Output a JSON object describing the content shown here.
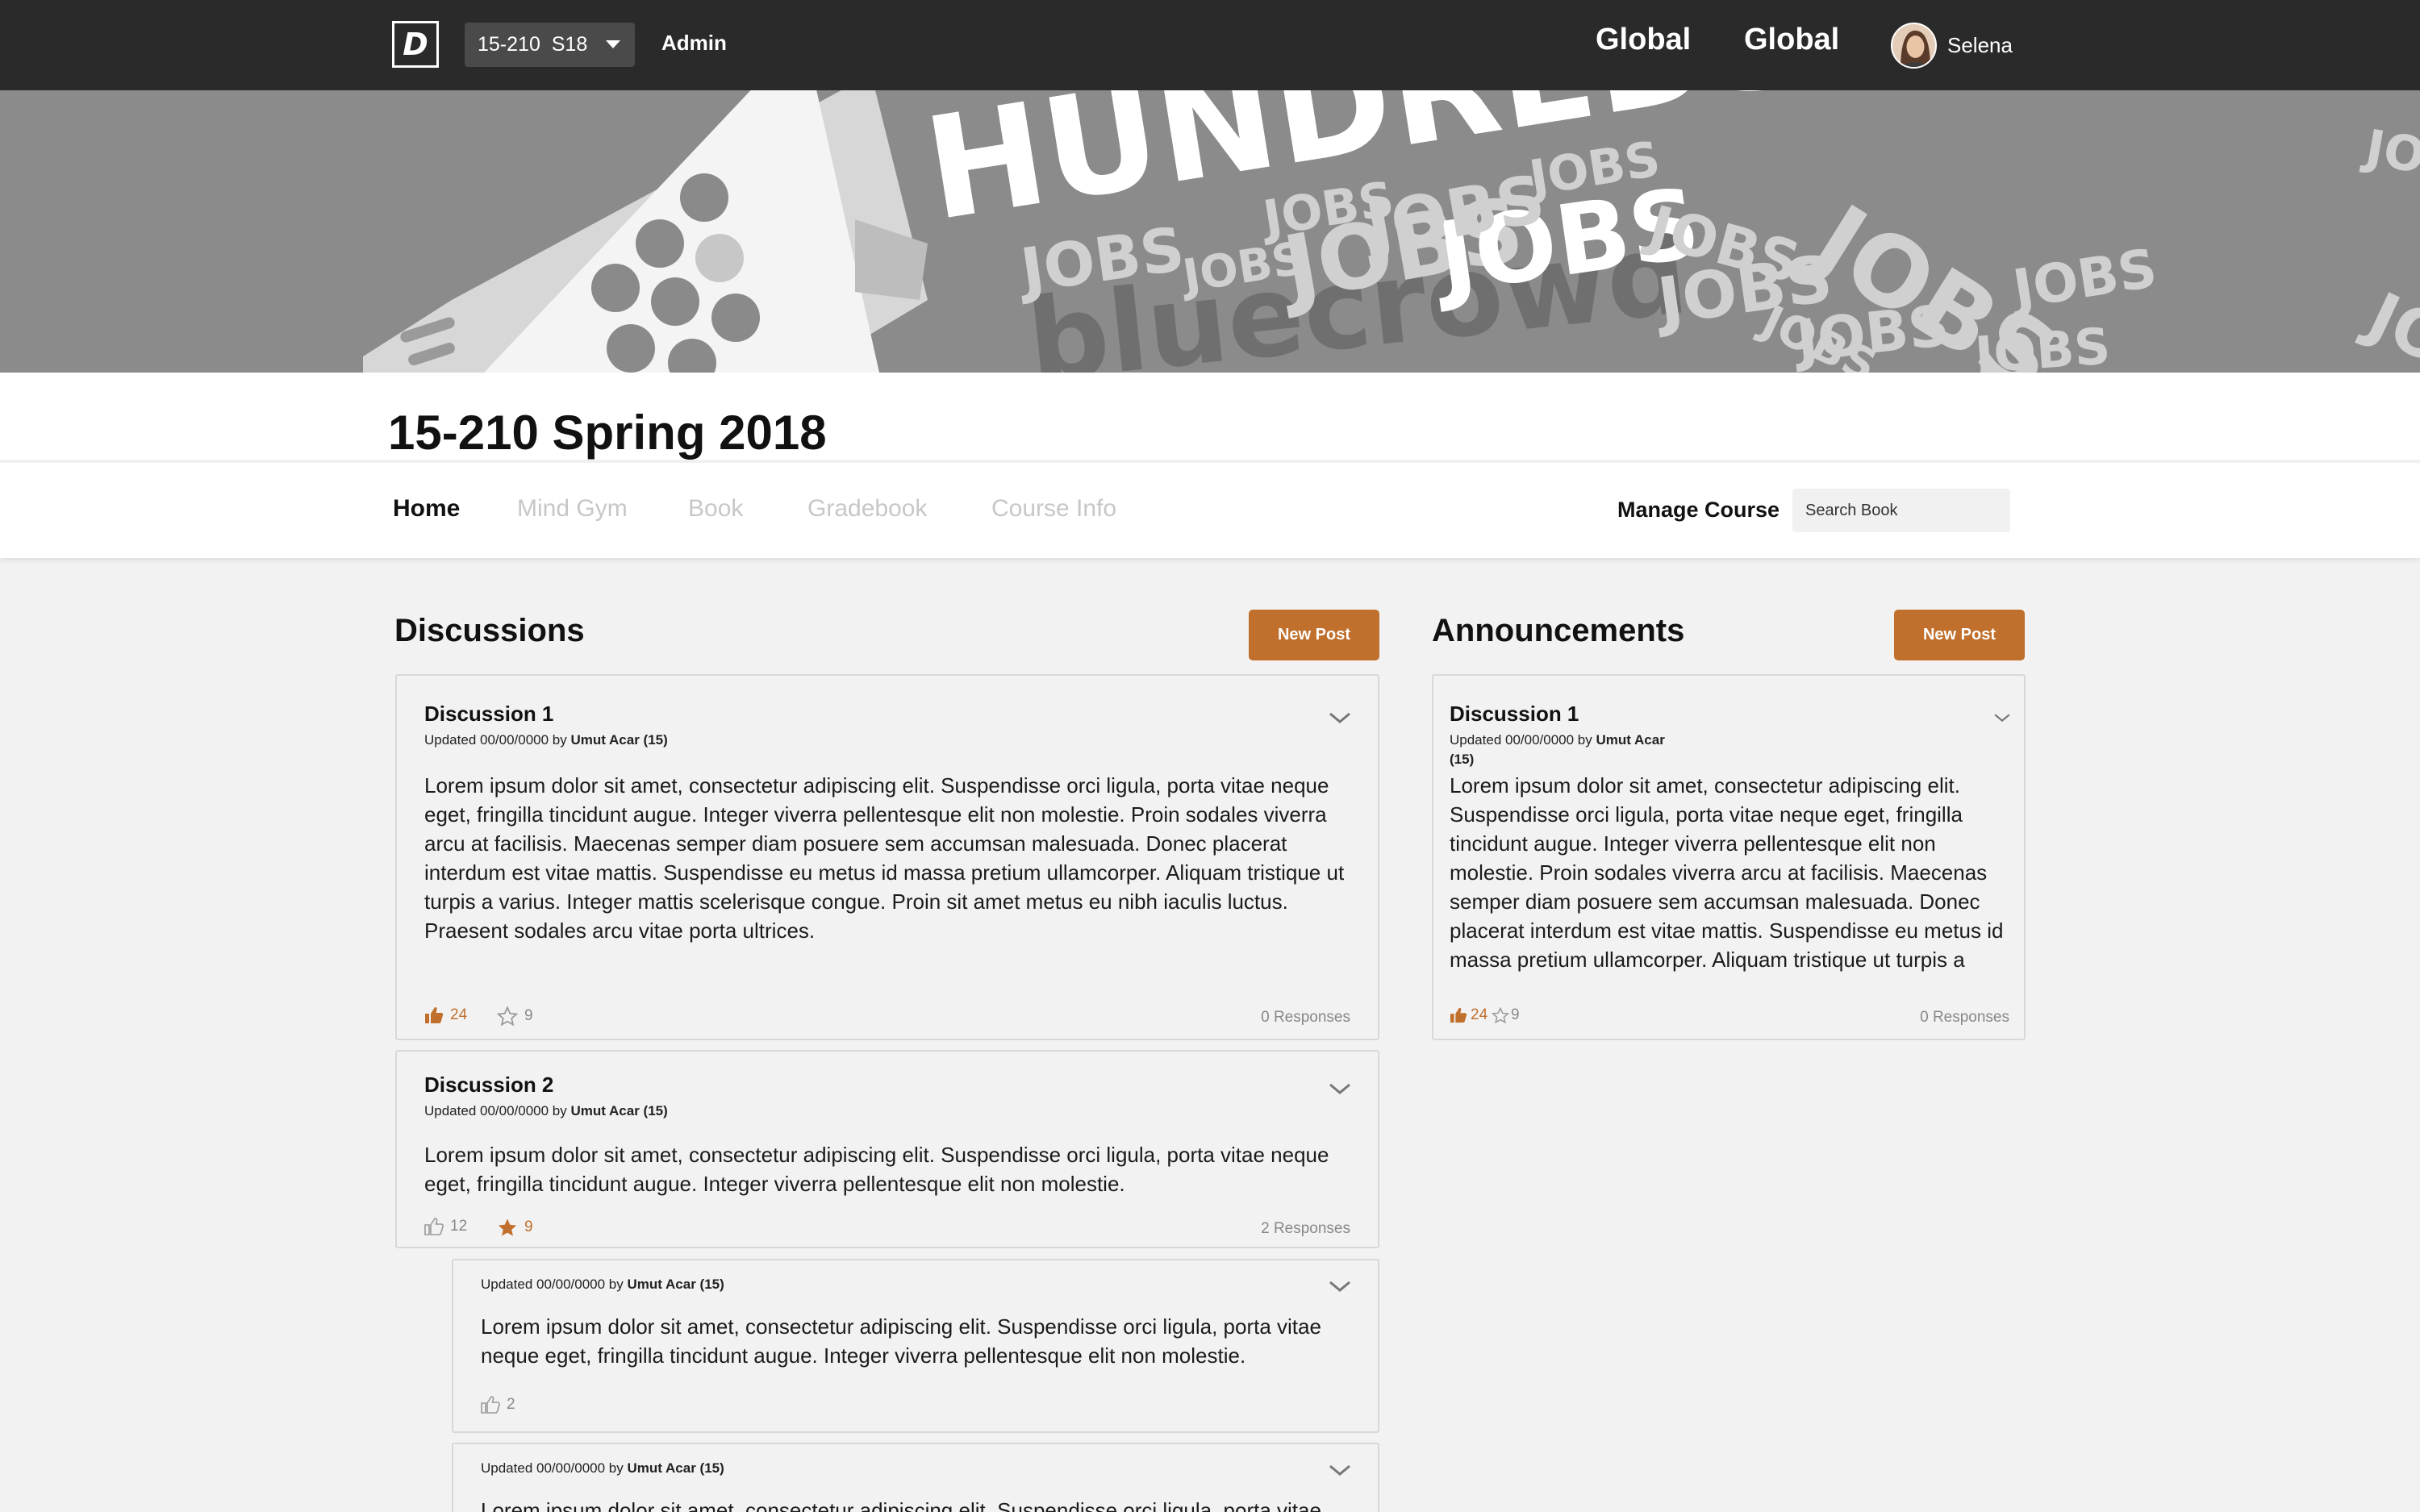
{
  "topbar": {
    "logo_letter": "D",
    "course_selector": "15-210  S18",
    "admin_label": "Admin",
    "global_links": [
      "Global",
      "Global"
    ],
    "user_name": "Selena"
  },
  "banner": {
    "big_text": "HUNDREDS OF JOBS",
    "repeat_word": "JOBS",
    "bottom_text": "bluecrowd"
  },
  "course": {
    "title": "15-210 Spring 2018"
  },
  "nav": {
    "tabs": [
      "Home",
      "Mind Gym",
      "Book",
      "Gradebook",
      "Course Info"
    ],
    "active_tab": "Home",
    "manage_course": "Manage Course",
    "search_placeholder": "Search Book"
  },
  "discussions": {
    "heading": "Discussions",
    "new_post_label": "New Post",
    "posts": [
      {
        "title": "Discussion 1",
        "meta_prefix": "Updated 00/00/0000 by",
        "author": "Umut Acar (15)",
        "body": "Lorem ipsum dolor sit amet, consectetur adipiscing elit. Suspendisse orci ligula, porta vitae neque eget, fringilla tincidunt augue. Integer viverra pellentesque elit non molestie. Proin sodales viverra arcu at facilisis. Maecenas semper diam posuere sem accumsan malesuada. Donec placerat interdum est vitae mattis. Suspendisse eu metus id massa pretium ullamcorper. Aliquam tristique ut turpis a varius. Integer mattis scelerisque congue. Proin sit amet metus eu nibh iaculis luctus. Praesent sodales arcu vitae porta ultrices.",
        "likes": "24",
        "stars": "9",
        "responses": "0 Responses"
      },
      {
        "title": "Discussion 2",
        "meta_prefix": "Updated 00/00/0000 by",
        "author": "Umut Acar (15)",
        "body": "Lorem ipsum dolor sit amet, consectetur adipiscing elit. Suspendisse orci ligula, porta vitae neque eget, fringilla tincidunt augue. Integer viverra pellentesque elit non molestie.",
        "likes": "12",
        "stars": "9",
        "responses": "2 Responses"
      }
    ],
    "replies": [
      {
        "meta_prefix": "Updated 00/00/0000 by",
        "author": "Umut Acar (15)",
        "body": "Lorem ipsum dolor sit amet, consectetur adipiscing elit. Suspendisse orci ligula, porta vitae neque eget, fringilla tincidunt augue. Integer viverra pellentesque elit non molestie.",
        "likes": "2"
      },
      {
        "meta_prefix": "Updated 00/00/0000 by",
        "author": "Umut Acar (15)",
        "body": "Lorem ipsum dolor sit amet, consectetur adipiscing elit. Suspendisse orci ligula, porta vitae"
      }
    ]
  },
  "announcements": {
    "heading": "Announcements",
    "new_post_label": "New Post",
    "posts": [
      {
        "title": "Discussion 1",
        "meta_prefix": "Updated 00/00/0000 by",
        "author": "Umut Acar",
        "author_suffix": "(15)",
        "body": "Lorem ipsum dolor sit amet, consectetur adipiscing elit. Suspendisse orci ligula, porta vitae neque eget, fringilla tincidunt augue. Integer viverra pellentesque elit non molestie. Proin sodales viverra arcu at facilisis. Maecenas semper diam posuere sem accumsan malesuada. Donec placerat interdum est vitae mattis. Suspendisse eu metus id massa pretium ullamcorper. Aliquam tristique ut turpis a",
        "likes": "24",
        "stars": "9",
        "responses": "0 Responses"
      }
    ]
  },
  "colors": {
    "accent": "#c0702c",
    "topbar": "#2a2a2a",
    "page_bg": "#f2f2f2"
  }
}
